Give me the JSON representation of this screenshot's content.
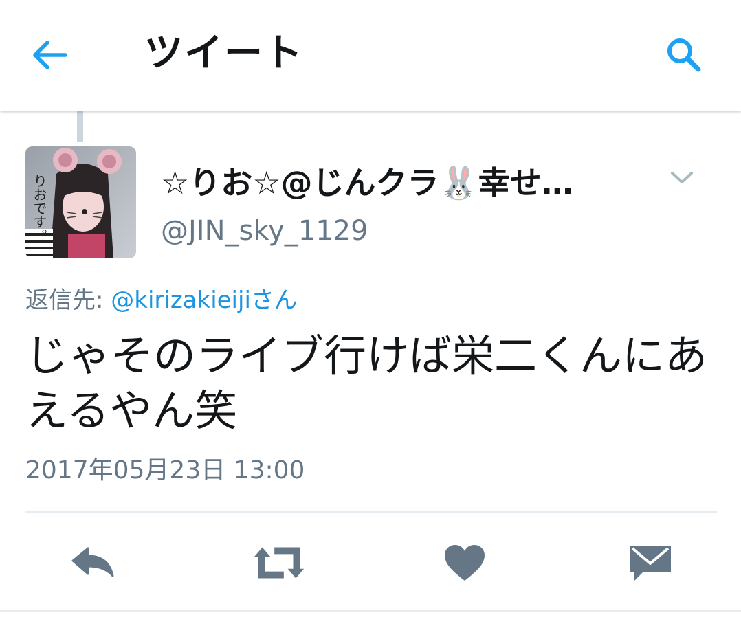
{
  "header": {
    "title": "ツイート",
    "back_icon": "back-arrow-icon",
    "search_icon": "search-icon",
    "accent_color": "#1da1f2"
  },
  "tweet": {
    "display_name": "☆りお☆@じんクラ🐰幸せ…",
    "handle": "@JIN_sky_1129",
    "avatar_text": "りおです。",
    "reply_prefix": "返信先: ",
    "reply_user": "@kirizakieiji",
    "reply_suffix": "さん",
    "text": "じゃそのライブ行けば栄二くんにあえるやん笑",
    "timestamp": "2017年05月23日 13:00"
  },
  "actions": [
    {
      "name": "reply",
      "icon": "reply-icon"
    },
    {
      "name": "retweet",
      "icon": "retweet-icon"
    },
    {
      "name": "like",
      "icon": "heart-icon"
    },
    {
      "name": "message",
      "icon": "envelope-icon"
    }
  ],
  "colors": {
    "text": "#14171a",
    "secondary": "#657786",
    "link": "#1b95e0",
    "action_icon": "#657786",
    "divider": "#e6ecf0"
  }
}
